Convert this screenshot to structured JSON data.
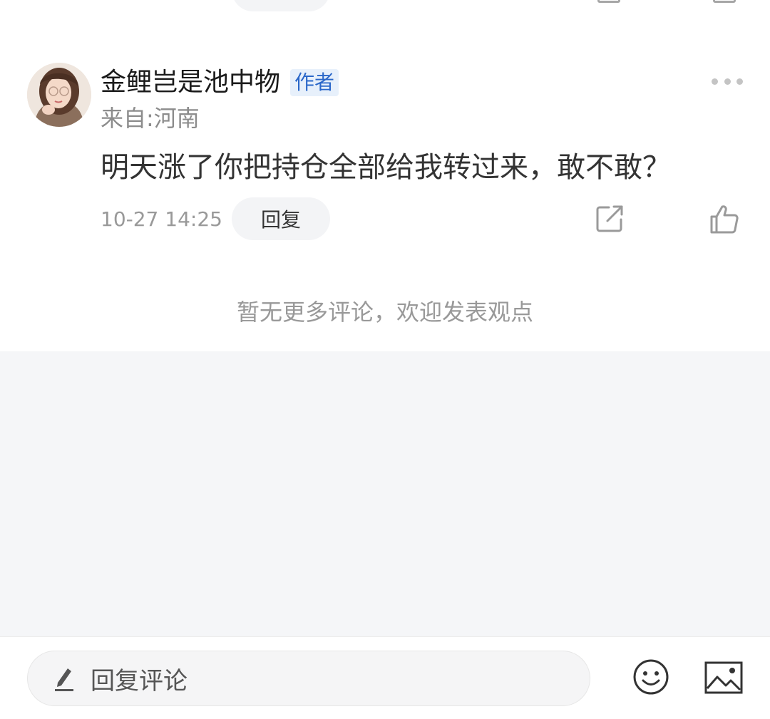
{
  "comment": {
    "username": "金鲤岂是池中物",
    "author_badge": "作者",
    "location": "来自:河南",
    "text": "明天涨了你把持仓全部给我转过来，敢不敢？",
    "timestamp": "10-27 14:25",
    "reply_label": "回复"
  },
  "footer_note": "暂无更多评论，欢迎发表观点",
  "bottom_bar": {
    "reply_placeholder": "回复评论"
  },
  "icons": {
    "more": "more-dots-icon",
    "share": "share-icon",
    "like": "thumbs-up-icon",
    "edit": "pencil-icon",
    "emoji": "smiley-icon",
    "image": "image-icon"
  },
  "colors": {
    "badge_text": "#2a67c9",
    "badge_bg": "#e7f0fb",
    "pill_bg": "#f3f4f6",
    "page_grey": "#f5f6f8"
  }
}
